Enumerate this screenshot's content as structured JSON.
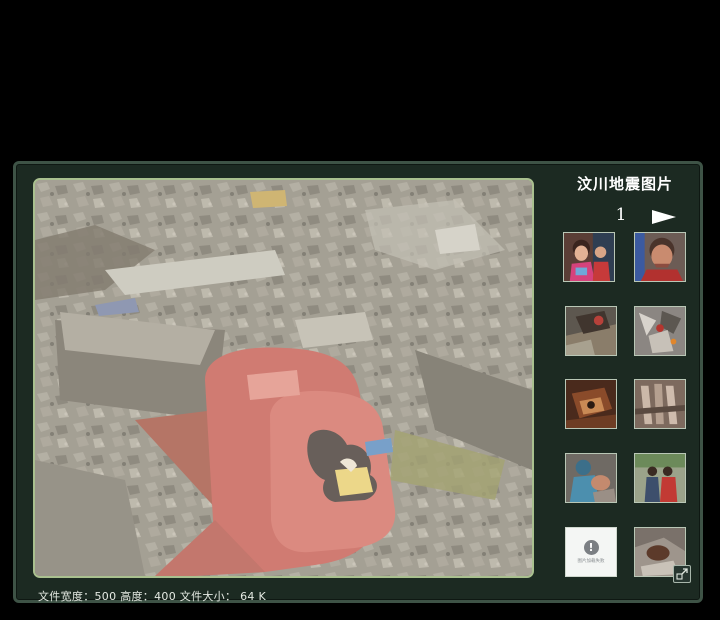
{
  "album": {
    "title": "汶川地震图片",
    "page_number": "1"
  },
  "icons": {
    "next": "play-triangle-right-icon",
    "expand": "corner-expand-icon",
    "broken_image": "exclamation-circle-icon"
  },
  "image_info": {
    "text": "文件宽度：500 高度：400 文件大小： 64 K"
  },
  "thumbnails": {
    "broken_label": "图片加载失败"
  },
  "colors": {
    "page_background": "#000000",
    "panel_background": "#1c2a22",
    "panel_border": "#3e5346",
    "photo_frame": "#a9c08f"
  }
}
